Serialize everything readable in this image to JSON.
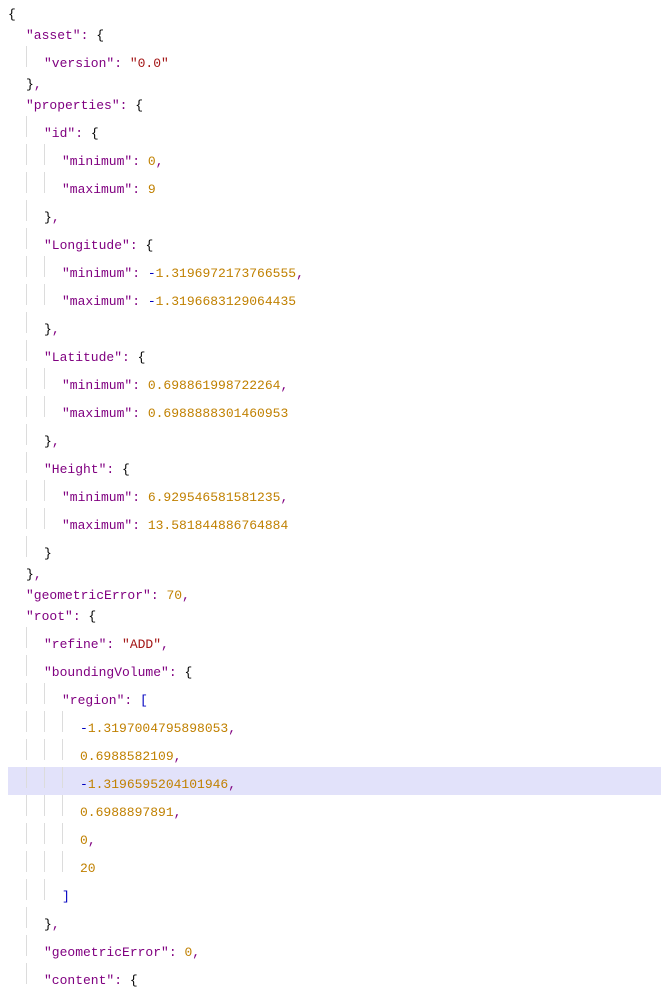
{
  "lines": [
    {
      "indent": 0,
      "segs": [
        {
          "t": "b",
          "v": "{"
        }
      ]
    },
    {
      "indent": 1,
      "segs": [
        {
          "t": "p",
          "v": "\"asset\""
        },
        {
          "t": "p",
          "v": ": "
        },
        {
          "t": "b",
          "v": "{"
        }
      ]
    },
    {
      "indent": 2,
      "segs": [
        {
          "t": "p",
          "v": "\"version\""
        },
        {
          "t": "p",
          "v": ": "
        },
        {
          "t": "str",
          "v": "\"0.0\""
        }
      ]
    },
    {
      "indent": 1,
      "segs": [
        {
          "t": "b",
          "v": "}"
        },
        {
          "t": "p",
          "v": ","
        }
      ]
    },
    {
      "indent": 1,
      "segs": [
        {
          "t": "p",
          "v": "\"properties\""
        },
        {
          "t": "p",
          "v": ": "
        },
        {
          "t": "b",
          "v": "{"
        }
      ]
    },
    {
      "indent": 2,
      "segs": [
        {
          "t": "p",
          "v": "\"id\""
        },
        {
          "t": "p",
          "v": ": "
        },
        {
          "t": "b",
          "v": "{"
        }
      ]
    },
    {
      "indent": 3,
      "segs": [
        {
          "t": "p",
          "v": "\"minimum\""
        },
        {
          "t": "p",
          "v": ": "
        },
        {
          "t": "num",
          "v": "0"
        },
        {
          "t": "p",
          "v": ","
        }
      ]
    },
    {
      "indent": 3,
      "segs": [
        {
          "t": "p",
          "v": "\"maximum\""
        },
        {
          "t": "p",
          "v": ": "
        },
        {
          "t": "num",
          "v": "9"
        }
      ]
    },
    {
      "indent": 2,
      "segs": [
        {
          "t": "b",
          "v": "}"
        },
        {
          "t": "p",
          "v": ","
        }
      ]
    },
    {
      "indent": 2,
      "segs": [
        {
          "t": "p",
          "v": "\"Longitude\""
        },
        {
          "t": "p",
          "v": ": "
        },
        {
          "t": "b",
          "v": "{"
        }
      ]
    },
    {
      "indent": 3,
      "segs": [
        {
          "t": "p",
          "v": "\"minimum\""
        },
        {
          "t": "p",
          "v": ": "
        },
        {
          "t": "neg",
          "v": "-"
        },
        {
          "t": "num",
          "v": "1.3196972173766555"
        },
        {
          "t": "p",
          "v": ","
        }
      ]
    },
    {
      "indent": 3,
      "segs": [
        {
          "t": "p",
          "v": "\"maximum\""
        },
        {
          "t": "p",
          "v": ": "
        },
        {
          "t": "neg",
          "v": "-"
        },
        {
          "t": "num",
          "v": "1.3196683129064435"
        }
      ]
    },
    {
      "indent": 2,
      "segs": [
        {
          "t": "b",
          "v": "}"
        },
        {
          "t": "p",
          "v": ","
        }
      ]
    },
    {
      "indent": 2,
      "segs": [
        {
          "t": "p",
          "v": "\"Latitude\""
        },
        {
          "t": "p",
          "v": ": "
        },
        {
          "t": "b",
          "v": "{"
        }
      ]
    },
    {
      "indent": 3,
      "segs": [
        {
          "t": "p",
          "v": "\"minimum\""
        },
        {
          "t": "p",
          "v": ": "
        },
        {
          "t": "num",
          "v": "0.698861998722264"
        },
        {
          "t": "p",
          "v": ","
        }
      ]
    },
    {
      "indent": 3,
      "segs": [
        {
          "t": "p",
          "v": "\"maximum\""
        },
        {
          "t": "p",
          "v": ": "
        },
        {
          "t": "num",
          "v": "0.6988888301460953"
        }
      ]
    },
    {
      "indent": 2,
      "segs": [
        {
          "t": "b",
          "v": "}"
        },
        {
          "t": "p",
          "v": ","
        }
      ]
    },
    {
      "indent": 2,
      "segs": [
        {
          "t": "p",
          "v": "\"Height\""
        },
        {
          "t": "p",
          "v": ": "
        },
        {
          "t": "b",
          "v": "{"
        }
      ]
    },
    {
      "indent": 3,
      "segs": [
        {
          "t": "p",
          "v": "\"minimum\""
        },
        {
          "t": "p",
          "v": ": "
        },
        {
          "t": "num",
          "v": "6.929546581581235"
        },
        {
          "t": "p",
          "v": ","
        }
      ]
    },
    {
      "indent": 3,
      "segs": [
        {
          "t": "p",
          "v": "\"maximum\""
        },
        {
          "t": "p",
          "v": ": "
        },
        {
          "t": "num",
          "v": "13.581844886764884"
        }
      ]
    },
    {
      "indent": 2,
      "segs": [
        {
          "t": "b",
          "v": "}"
        }
      ]
    },
    {
      "indent": 1,
      "segs": [
        {
          "t": "b",
          "v": "}"
        },
        {
          "t": "p",
          "v": ","
        }
      ]
    },
    {
      "indent": 1,
      "segs": [
        {
          "t": "p",
          "v": "\"geometricError\""
        },
        {
          "t": "p",
          "v": ": "
        },
        {
          "t": "num",
          "v": "70"
        },
        {
          "t": "p",
          "v": ","
        }
      ]
    },
    {
      "indent": 1,
      "segs": [
        {
          "t": "p",
          "v": "\"root\""
        },
        {
          "t": "p",
          "v": ": "
        },
        {
          "t": "b",
          "v": "{"
        }
      ]
    },
    {
      "indent": 2,
      "segs": [
        {
          "t": "p",
          "v": "\"refine\""
        },
        {
          "t": "p",
          "v": ": "
        },
        {
          "t": "str",
          "v": "\"ADD\""
        },
        {
          "t": "p",
          "v": ","
        }
      ]
    },
    {
      "indent": 2,
      "segs": [
        {
          "t": "p",
          "v": "\"boundingVolume\""
        },
        {
          "t": "p",
          "v": ": "
        },
        {
          "t": "b",
          "v": "{"
        }
      ]
    },
    {
      "indent": 3,
      "segs": [
        {
          "t": "p",
          "v": "\"region\""
        },
        {
          "t": "p",
          "v": ": "
        },
        {
          "t": "br",
          "v": "["
        }
      ]
    },
    {
      "indent": 4,
      "segs": [
        {
          "t": "neg",
          "v": "-"
        },
        {
          "t": "num",
          "v": "1.3197004795898053"
        },
        {
          "t": "p",
          "v": ","
        }
      ]
    },
    {
      "indent": 4,
      "segs": [
        {
          "t": "num",
          "v": "0.6988582109"
        },
        {
          "t": "p",
          "v": ","
        }
      ]
    },
    {
      "indent": 4,
      "hl": true,
      "segs": [
        {
          "t": "neg",
          "v": "-"
        },
        {
          "t": "num",
          "v": "1.3196595204101946"
        },
        {
          "t": "p",
          "v": ","
        }
      ]
    },
    {
      "indent": 4,
      "segs": [
        {
          "t": "num",
          "v": "0.6988897891"
        },
        {
          "t": "p",
          "v": ","
        }
      ]
    },
    {
      "indent": 4,
      "segs": [
        {
          "t": "num",
          "v": "0"
        },
        {
          "t": "p",
          "v": ","
        }
      ]
    },
    {
      "indent": 4,
      "segs": [
        {
          "t": "num",
          "v": "20"
        }
      ]
    },
    {
      "indent": 3,
      "segs": [
        {
          "t": "br",
          "v": "]"
        }
      ]
    },
    {
      "indent": 2,
      "segs": [
        {
          "t": "b",
          "v": "}"
        },
        {
          "t": "p",
          "v": ","
        }
      ]
    },
    {
      "indent": 2,
      "segs": [
        {
          "t": "p",
          "v": "\"geometricError\""
        },
        {
          "t": "p",
          "v": ": "
        },
        {
          "t": "num",
          "v": "0"
        },
        {
          "t": "p",
          "v": ","
        }
      ]
    },
    {
      "indent": 2,
      "segs": [
        {
          "t": "p",
          "v": "\"content\""
        },
        {
          "t": "p",
          "v": ": "
        },
        {
          "t": "b",
          "v": "{"
        }
      ]
    }
  ],
  "indent_width": 18,
  "colors": {
    "key": "#800080",
    "string": "#a31515",
    "number": "#c08000",
    "operator_neg": "#0000c0",
    "bracket": "#0000c0",
    "brace": "#000000",
    "highlight_bg": "#e2e2fa",
    "guide": "#dcdcdc"
  }
}
